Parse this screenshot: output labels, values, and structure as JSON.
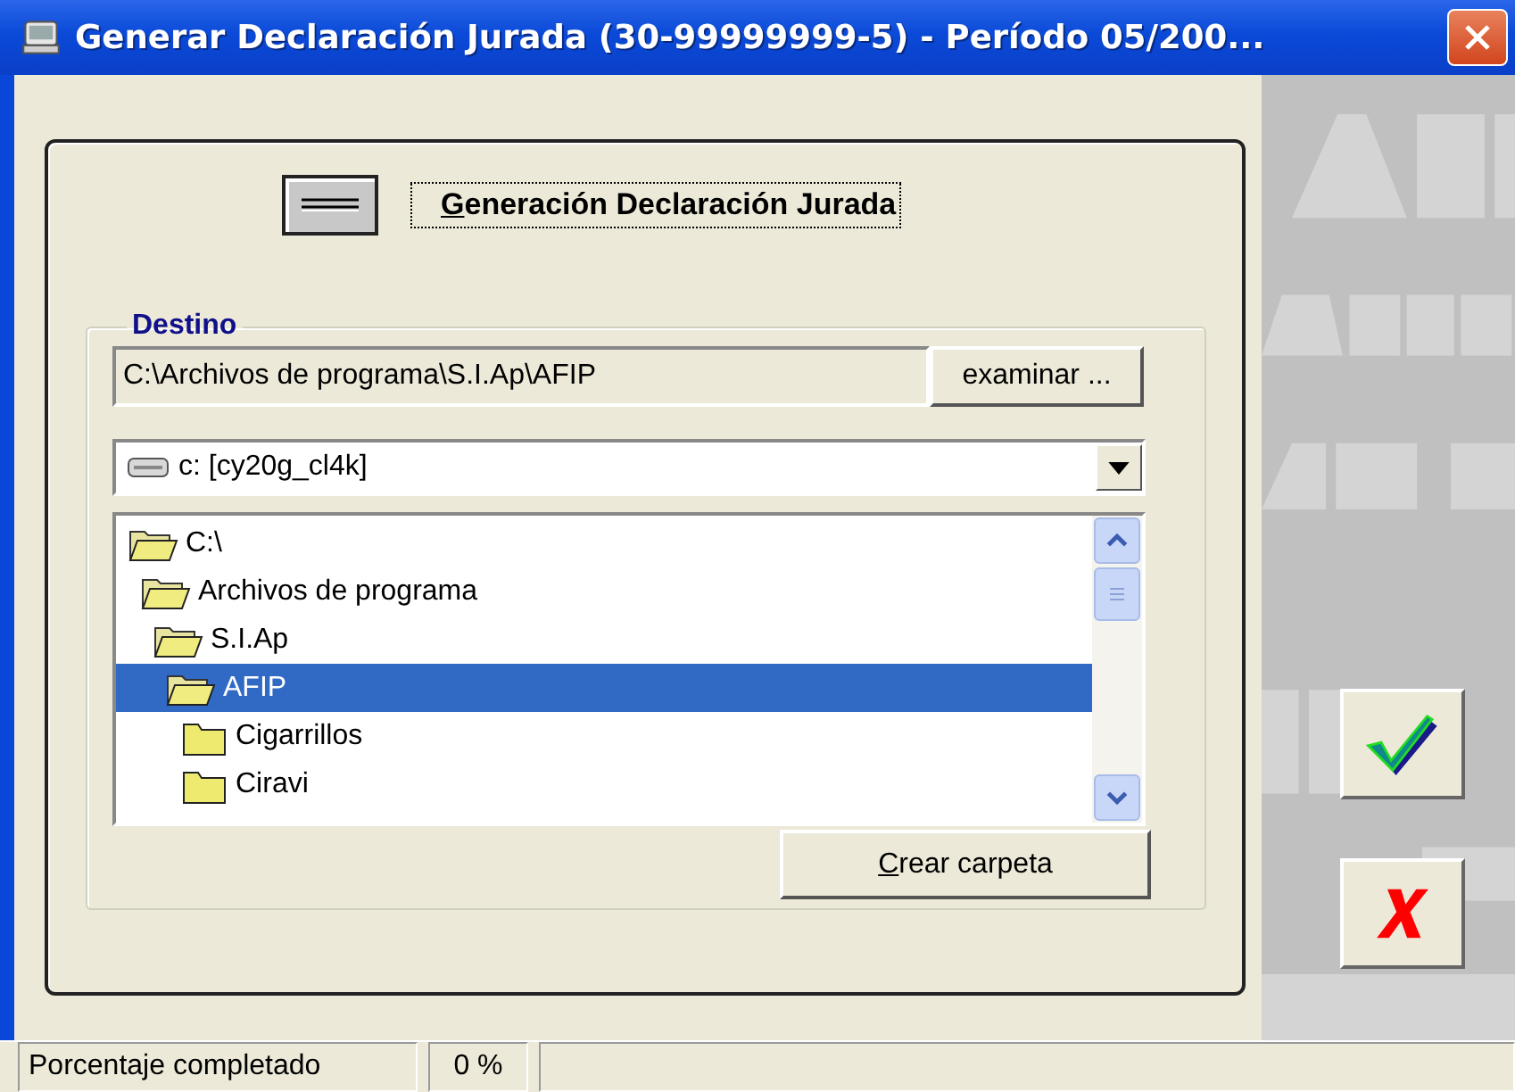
{
  "window": {
    "title": "Generar Declaración Jurada (30-99999999-5) - Período 05/200..."
  },
  "header": {
    "label": "Generación Declaración Jurada"
  },
  "destino": {
    "legend": "Destino",
    "path": "C:\\Archivos de programa\\S.I.Ap\\AFIP",
    "browse_button": "examinar ...",
    "drive": "c: [cy20g_cl4k]",
    "tree": [
      {
        "label": "C:\\",
        "expanded": true,
        "selected": false,
        "children": [
          {
            "label": "Archivos de programa",
            "expanded": true,
            "selected": false,
            "children": [
              {
                "label": "S.I.Ap",
                "expanded": true,
                "selected": false,
                "children": [
                  {
                    "label": "AFIP",
                    "expanded": true,
                    "selected": true,
                    "children": [
                      {
                        "label": "Cigarrillos",
                        "expanded": false,
                        "selected": false
                      },
                      {
                        "label": "Ciravi",
                        "expanded": false,
                        "selected": false
                      }
                    ]
                  }
                ]
              }
            ]
          }
        ]
      }
    ],
    "new_folder_button": "Crear carpeta"
  },
  "status_bar": {
    "label": "Porcentaje completado",
    "percent": "0 %"
  }
}
